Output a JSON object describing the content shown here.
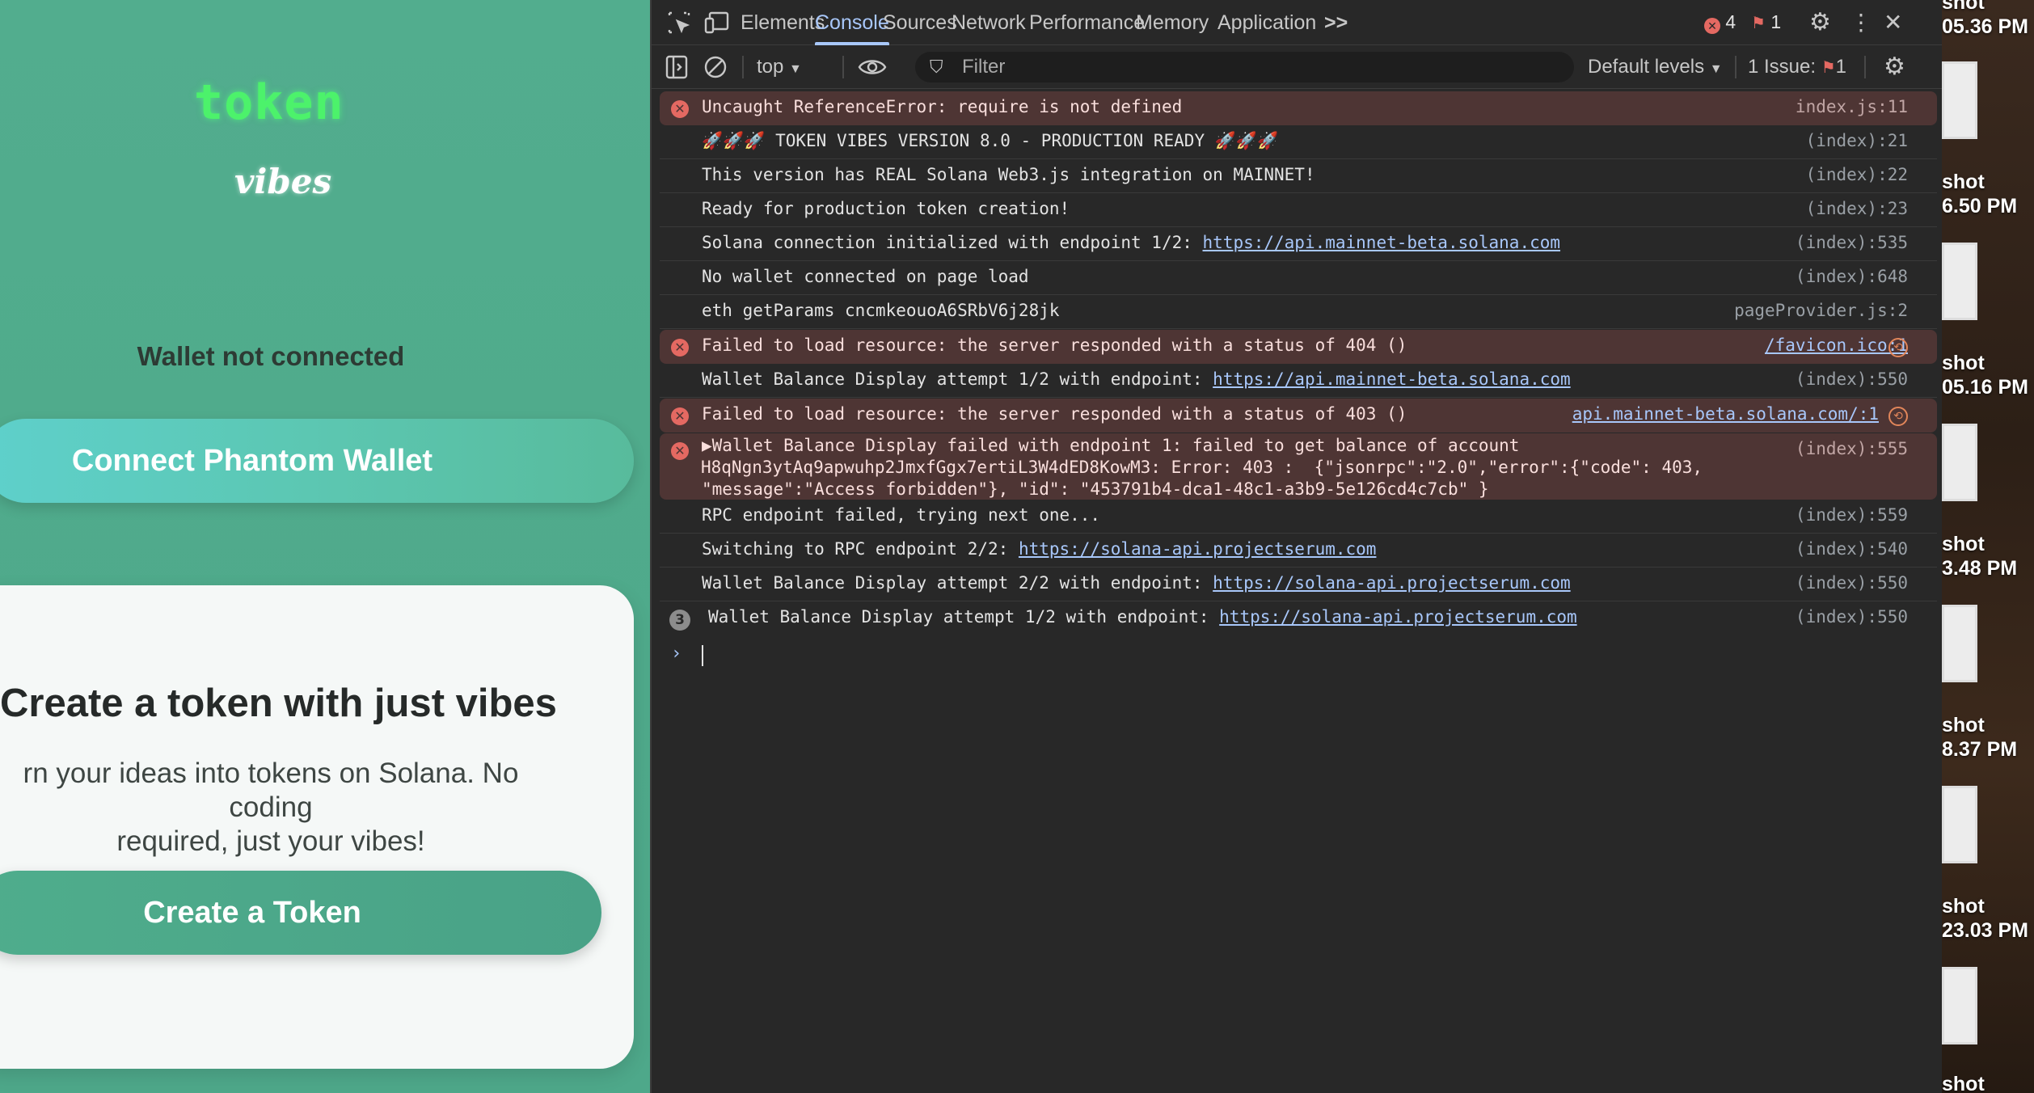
{
  "app": {
    "logo_token": "token",
    "logo_vibes": "vibes",
    "wallet_status": "Wallet not connected",
    "connect_button": "Connect Phantom Wallet",
    "card_title": "Create a token with just vibes",
    "card_desc_line1": "rn your ideas into tokens on Solana. No coding",
    "card_desc_line2": "required, just your vibes!",
    "create_button": "Create a Token",
    "colors": {
      "bg": "#52ad8e",
      "logo_green": "#4cf26b",
      "connect_btn": "#5ed0cb",
      "create_btn": "#4fad8c"
    }
  },
  "devtools": {
    "tabs": [
      "Elements",
      "Console",
      "Sources",
      "Network",
      "Performance",
      "Memory",
      "Application"
    ],
    "active_tab": "Console",
    "more_tabs": ">>",
    "error_count": "4",
    "issue_count": "1",
    "toolbar": {
      "context": "top",
      "filter_placeholder": "Filter",
      "levels": "Default levels",
      "issues_label": "1 Issue:",
      "issues_count": "1"
    },
    "messages": [
      {
        "type": "error",
        "text": "Uncaught ReferenceError: require is not defined",
        "src": "index.js:11"
      },
      {
        "type": "log",
        "text": "🚀🚀🚀 TOKEN VIBES VERSION 8.0 - PRODUCTION READY 🚀🚀🚀",
        "src": "(index):21"
      },
      {
        "type": "log",
        "text": "This version has REAL Solana Web3.js integration on MAINNET!",
        "src": "(index):22"
      },
      {
        "type": "log",
        "text": "Ready for production token creation!",
        "src": "(index):23"
      },
      {
        "type": "log",
        "text": "Solana connection initialized with endpoint 1/2: ",
        "link": "https://api.mainnet-beta.solana.com",
        "src": "(index):535"
      },
      {
        "type": "log",
        "text": "No wallet connected on page load",
        "src": "(index):648"
      },
      {
        "type": "log",
        "text": "eth getParams cncmkeouoA6SRbV6j28jk",
        "src": "pageProvider.js:2"
      },
      {
        "type": "error",
        "text": "Failed to load resource: the server responded with a status of 404 ()",
        "src_link": "/favicon.ico:1"
      },
      {
        "type": "log",
        "text": "Wallet Balance Display attempt 1/2 with endpoint: ",
        "link": "https://api.mainnet-beta.solana.com",
        "src": "(index):550"
      },
      {
        "type": "error",
        "text": "Failed to load resource: the server responded with a status of 403 ()",
        "src_link": "api.mainnet-beta.solana.com/:1"
      },
      {
        "type": "error_tall",
        "line1": "▶Wallet Balance Display failed with endpoint 1: failed to get balance of account",
        "line2": "H8qNgn3ytAq9apwuhp2JmxfGgx7ertiL3W4dED8KowM3: Error: 403 :  {\"jsonrpc\":\"2.0\",\"error\":{\"code\": 403,",
        "line3": "\"message\":\"Access forbidden\"}, \"id\": \"453791b4-dca1-48c1-a3b9-5e126cd4c7cb\" }",
        "src": "(index):555"
      },
      {
        "type": "log",
        "text": "RPC endpoint failed, trying next one...",
        "src": "(index):559"
      },
      {
        "type": "log",
        "text": "Switching to RPC endpoint 2/2: ",
        "link": "https://solana-api.projectserum.com",
        "src": "(index):540"
      },
      {
        "type": "log",
        "text": "Wallet Balance Display attempt 2/2 with endpoint: ",
        "link": "https://solana-api.projectserum.com",
        "src": "(index):550"
      },
      {
        "type": "log",
        "repeat": "3",
        "text": "Wallet Balance Display attempt 1/2 with endpoint: ",
        "link": "https://solana-api.projectserum.com",
        "src": "(index):550"
      }
    ]
  },
  "desktop": {
    "labels": [
      {
        "line1": "shot",
        "line2": "05.36 PM"
      },
      {
        "line1": "shot",
        "line2": "6.50 PM"
      },
      {
        "line1": "shot",
        "line2": "05.16 PM"
      },
      {
        "line1": "shot",
        "line2": "3.48 PM"
      },
      {
        "line1": "shot",
        "line2": "8.37 PM"
      },
      {
        "line1": "shot",
        "line2": "23.03 PM"
      },
      {
        "line1": "shot",
        "line2": ""
      }
    ]
  }
}
